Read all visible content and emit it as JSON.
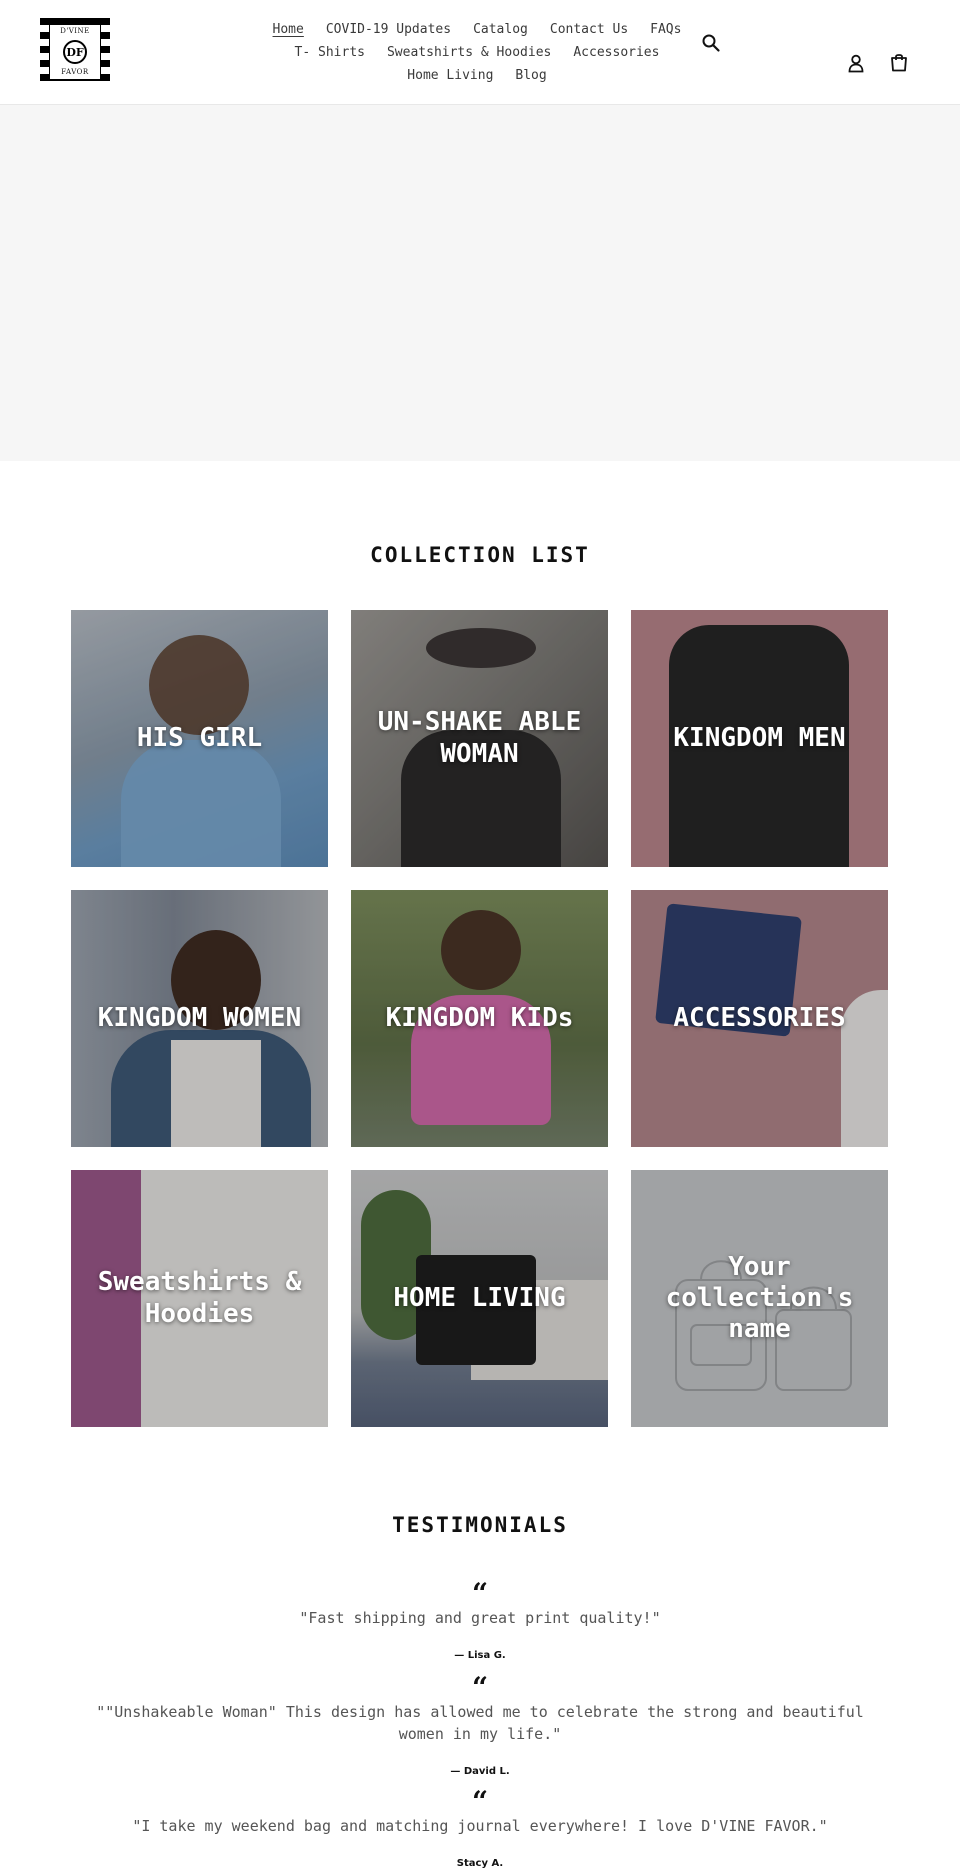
{
  "brand": {
    "logo_top": "D'VINE",
    "logo_bottom": "FAVOR",
    "logo_mark": "DF"
  },
  "nav": {
    "row1": [
      "Home",
      "COVID-19 Updates",
      "Catalog",
      "Contact Us",
      "FAQs"
    ],
    "row2": [
      "T- Shirts",
      "Sweatshirts & Hoodies",
      "Accessories"
    ],
    "row3": [
      "Home Living",
      "Blog"
    ],
    "active": "Home"
  },
  "icons": {
    "search": "search-icon",
    "account": "account-icon",
    "cart": "cart-icon"
  },
  "collection_list": {
    "title": "COLLECTION LIST",
    "items": [
      {
        "label": "HIS GIRL",
        "color": "#7e94ad"
      },
      {
        "label": "UN-SHAKE ABLE WOMAN",
        "color": "#6f6c68"
      },
      {
        "label": "KINGDOM MEN",
        "color": "#a8767b"
      },
      {
        "label": "KINGDOM WOMEN",
        "color": "#6e7684"
      },
      {
        "label": "KINGDOM KIDs",
        "color": "#6d7a5a"
      },
      {
        "label": "ACCESSORIES",
        "color": "#9d7a7e"
      },
      {
        "label": "Sweatshirts & Hoodies",
        "color": "#8a4f79"
      },
      {
        "label": "HOME LIVING",
        "color": "#8f9394"
      },
      {
        "label": "Your collection's name",
        "color": "#a7a9ac"
      }
    ]
  },
  "testimonials": {
    "title": "TESTIMONIALS",
    "items": [
      {
        "mark": "“",
        "text": "\"Fast shipping and great print quality!\"",
        "author": "— Lisa G."
      },
      {
        "mark": "“",
        "text": "\"\"Unshakeable Woman\" This design has allowed me to celebrate the strong and beautiful women in my life.\"",
        "author": "— David L."
      },
      {
        "mark": "“",
        "text": "\"I take my weekend bag and matching journal everywhere! I love D'VINE FAVOR.\"",
        "author": "Stacy A."
      }
    ]
  }
}
